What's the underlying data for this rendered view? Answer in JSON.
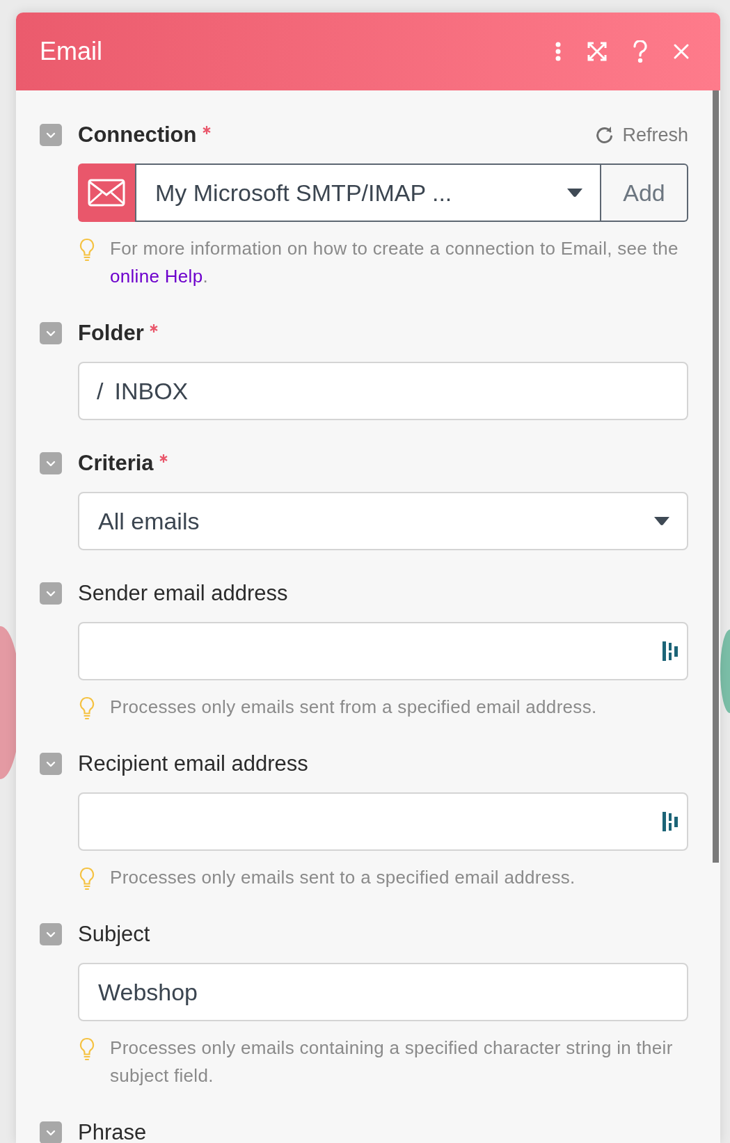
{
  "panel": {
    "title": "Email"
  },
  "fields": [
    {
      "kind": "connection",
      "label": "Connection",
      "required": true,
      "expanded": true,
      "refresh": "Refresh",
      "value": "My Microsoft SMTP/IMAP ...",
      "add": "Add",
      "hint": "For more information on how to create a connection to Email, see the",
      "hint_link": "online Help",
      "hint_end": "."
    },
    {
      "kind": "path",
      "label": "Folder",
      "required": true,
      "expanded": true,
      "prefix": "/",
      "value": "INBOX"
    },
    {
      "kind": "select",
      "label": "Criteria",
      "required": true,
      "expanded": true,
      "value": "All emails"
    },
    {
      "kind": "mappable",
      "label": "Sender email address",
      "required": false,
      "expanded": true,
      "hint": "Processes only emails sent from a specified email address."
    },
    {
      "kind": "mappable",
      "label": "Recipient email address",
      "required": false,
      "expanded": true,
      "hint": "Processes only emails sent to a specified email address."
    },
    {
      "kind": "text",
      "label": "Subject",
      "required": false,
      "expanded": true,
      "value": "Webshop",
      "hint": "Processes only emails containing a specified character string in their subject field."
    },
    {
      "kind": "label",
      "label": "Phrase",
      "required": false,
      "expanded": true
    }
  ]
}
